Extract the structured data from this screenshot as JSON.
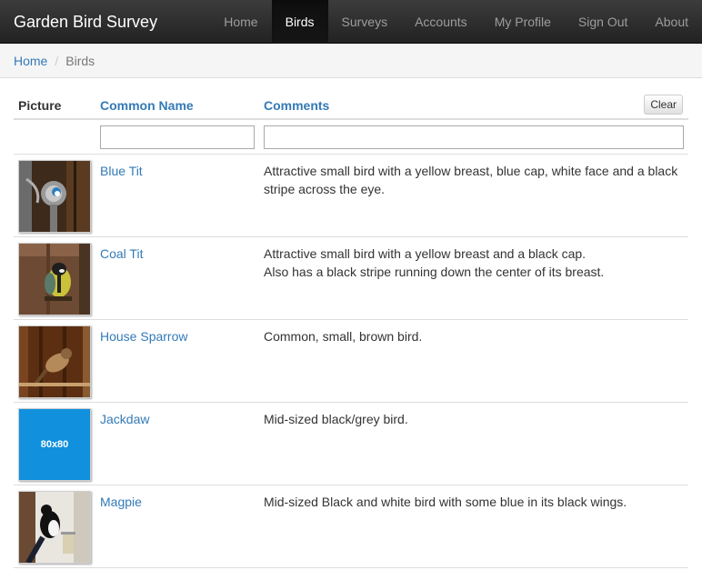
{
  "app": {
    "title": "Garden Bird Survey"
  },
  "nav": {
    "items": [
      {
        "label": "Home",
        "active": false
      },
      {
        "label": "Birds",
        "active": true
      },
      {
        "label": "Surveys",
        "active": false
      },
      {
        "label": "Accounts",
        "active": false
      },
      {
        "label": "My Profile",
        "active": false
      },
      {
        "label": "Sign Out",
        "active": false
      },
      {
        "label": "About",
        "active": false
      }
    ]
  },
  "breadcrumb": {
    "home": "Home",
    "separator": "/",
    "current": "Birds"
  },
  "table": {
    "headers": {
      "picture": "Picture",
      "name": "Common Name",
      "comments": "Comments"
    },
    "clear_label": "Clear",
    "filters": {
      "name_value": "",
      "comments_value": ""
    },
    "rows": [
      {
        "name": "Blue Tit",
        "comment_lines": [
          "Attractive small bird with a yellow breast, blue cap, white face and a black stripe across the eye."
        ],
        "image": "blue-tit-photo"
      },
      {
        "name": "Coal Tit",
        "comment_lines": [
          "Attractive small bird with a yellow breast and a black cap.",
          "Also has a black stripe running down the center of its breast."
        ],
        "image": "coal-tit-photo"
      },
      {
        "name": "House Sparrow",
        "comment_lines": [
          "Common, small, brown bird."
        ],
        "image": "house-sparrow-photo"
      },
      {
        "name": "Jackdaw",
        "comment_lines": [
          "Mid-sized black/grey bird."
        ],
        "image": "placeholder",
        "placeholder_text": "80x80"
      },
      {
        "name": "Magpie",
        "comment_lines": [
          "Mid-sized Black and white bird with some blue in its black wings."
        ],
        "image": "magpie-photo"
      }
    ]
  },
  "colors": {
    "link": "#337ab7",
    "navbar_dark": "#222222",
    "navbar_text": "#9d9d9d",
    "placeholder_blue": "#1190dd"
  }
}
